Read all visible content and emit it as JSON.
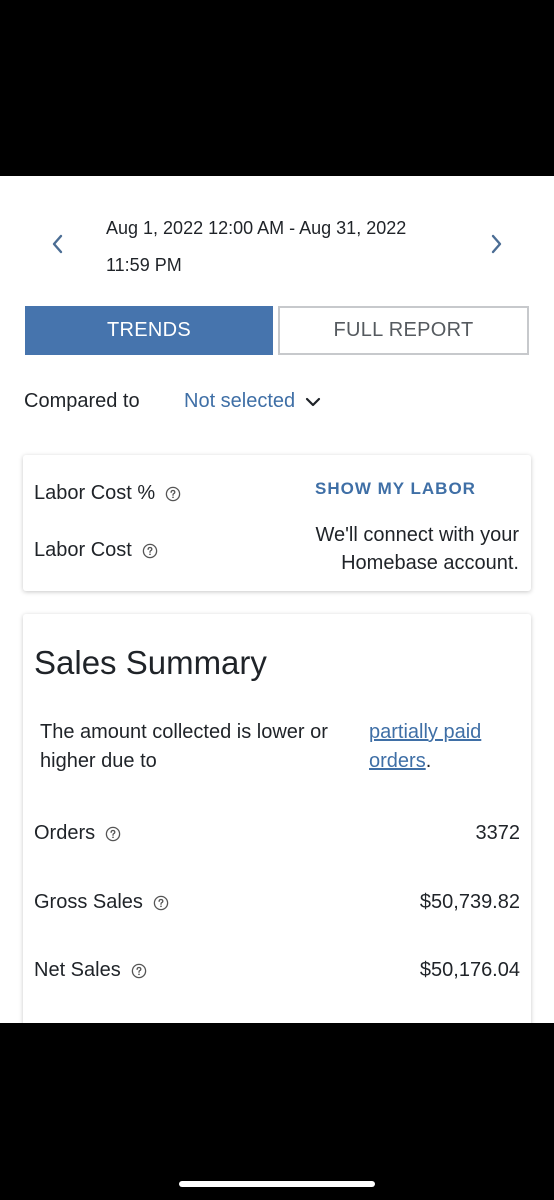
{
  "date_range": {
    "line1": "Aug 1, 2022 12:00 AM - Aug 31, 2022",
    "line2": "11:59 PM"
  },
  "tabs": [
    {
      "label": "TRENDS",
      "active": true
    },
    {
      "label": "FULL REPORT",
      "active": false
    }
  ],
  "compare": {
    "label": "Compared to",
    "value": "Not selected"
  },
  "labor": {
    "cost_percent_label": "Labor Cost %",
    "cost_label": "Labor Cost",
    "show_button": "SHOW MY LABOR",
    "connect_text": "We'll connect with your Homebase account."
  },
  "sales": {
    "title": "Sales Summary",
    "note": "The amount collected is lower or higher due to",
    "note_link": "partially paid orders",
    "note_period": ".",
    "rows": [
      {
        "label": "Orders",
        "value": "3372"
      },
      {
        "label": "Gross Sales",
        "value": "$50,739.82"
      },
      {
        "label": "Net Sales",
        "value": "$50,176.04"
      }
    ]
  },
  "colors": {
    "accent": "#4674ad",
    "link": "#3f6fa6",
    "text": "#1f2328"
  },
  "icons": {
    "prev": "chevron-left-icon",
    "next": "chevron-right-icon",
    "dropdown": "chevron-down-icon",
    "help": "question-circle-icon"
  }
}
